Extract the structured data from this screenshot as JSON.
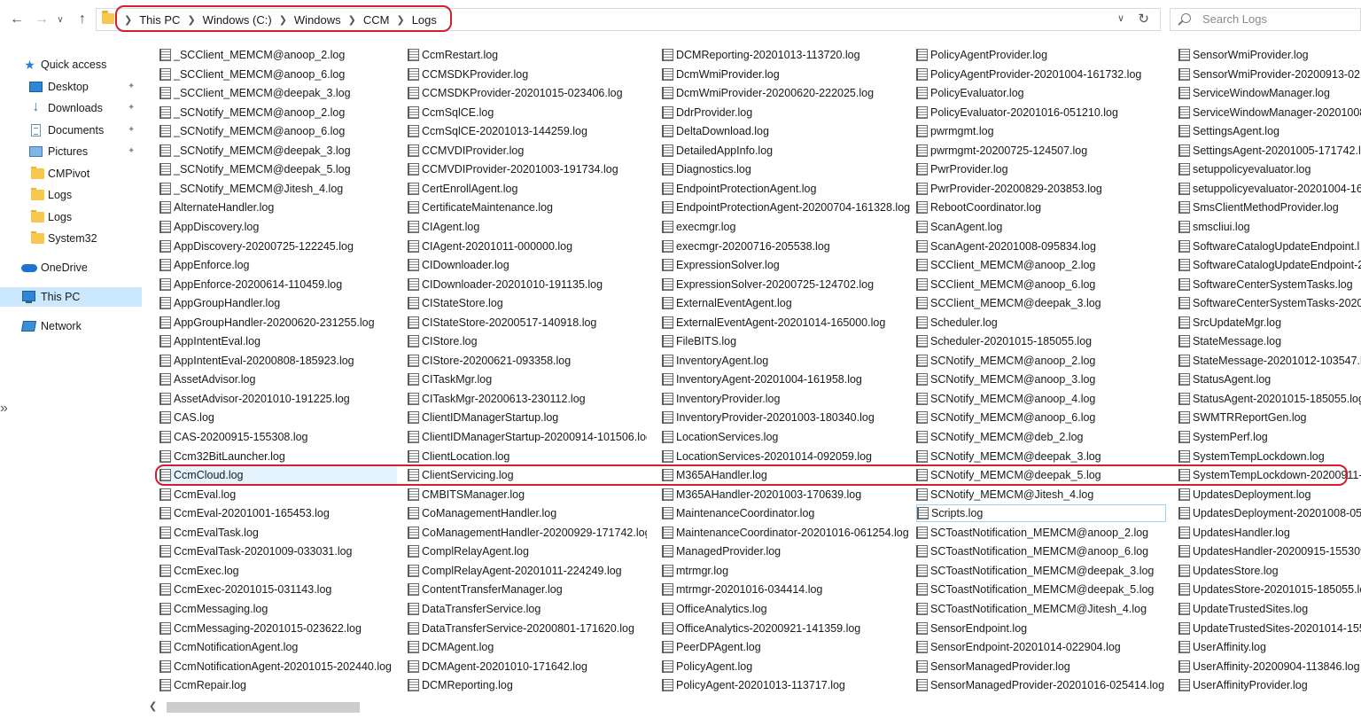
{
  "window": {
    "breadcrumb": [
      "This PC",
      "Windows (C:)",
      "Windows",
      "CCM",
      "Logs"
    ],
    "search_placeholder": "Search Logs"
  },
  "nav": {
    "back_icon": "arrow-left-icon",
    "forward_icon": "arrow-right-icon",
    "up_icon": "arrow-up-icon",
    "items": [
      {
        "label": "Quick access",
        "icon": "star-icon",
        "pinned": false
      },
      {
        "label": "Desktop",
        "icon": "desktop-icon",
        "pinned": true
      },
      {
        "label": "Downloads",
        "icon": "download-icon",
        "pinned": true
      },
      {
        "label": "Documents",
        "icon": "document-icon",
        "pinned": true
      },
      {
        "label": "Pictures",
        "icon": "pictures-icon",
        "pinned": true
      },
      {
        "label": "CMPivot",
        "icon": "folder-icon",
        "pinned": false
      },
      {
        "label": "Logs",
        "icon": "folder-icon",
        "pinned": false
      },
      {
        "label": "Logs",
        "icon": "folder-icon",
        "pinned": false
      },
      {
        "label": "System32",
        "icon": "folder-icon",
        "pinned": false
      },
      {
        "label": "OneDrive",
        "icon": "cloud-icon",
        "pinned": false
      },
      {
        "label": "This PC",
        "icon": "computer-icon",
        "pinned": false,
        "selected": true
      },
      {
        "label": "Network",
        "icon": "network-icon",
        "pinned": false
      }
    ]
  },
  "files": {
    "columns": [
      [
        "_SCClient_MEMCM@anoop_2.log",
        "_SCClient_MEMCM@anoop_6.log",
        "_SCClient_MEMCM@deepak_3.log",
        "_SCNotify_MEMCM@anoop_2.log",
        "_SCNotify_MEMCM@anoop_6.log",
        "_SCNotify_MEMCM@deepak_3.log",
        "_SCNotify_MEMCM@deepak_5.log",
        "_SCNotify_MEMCM@Jitesh_4.log",
        "AlternateHandler.log",
        "AppDiscovery.log",
        "AppDiscovery-20200725-122245.log",
        "AppEnforce.log",
        "AppEnforce-20200614-110459.log",
        "AppGroupHandler.log",
        "AppGroupHandler-20200620-231255.log",
        "AppIntentEval.log",
        "AppIntentEval-20200808-185923.log",
        "AssetAdvisor.log",
        "AssetAdvisor-20201010-191225.log",
        "CAS.log",
        "CAS-20200915-155308.log",
        "Ccm32BitLauncher.log",
        "CcmCloud.log",
        "CcmEval.log",
        "CcmEval-20201001-165453.log",
        "CcmEvalTask.log",
        "CcmEvalTask-20201009-033031.log",
        "CcmExec.log",
        "CcmExec-20201015-031143.log",
        "CcmMessaging.log",
        "CcmMessaging-20201015-023622.log",
        "CcmNotificationAgent.log",
        "CcmNotificationAgent-20201015-202440.log",
        "CcmRepair.log"
      ],
      [
        "CcmRestart.log",
        "CCMSDKProvider.log",
        "CCMSDKProvider-20201015-023406.log",
        "CcmSqlCE.log",
        "CcmSqlCE-20201013-144259.log",
        "CCMVDIProvider.log",
        "CCMVDIProvider-20201003-191734.log",
        "CertEnrollAgent.log",
        "CertificateMaintenance.log",
        "CIAgent.log",
        "CIAgent-20201011-000000.log",
        "CIDownloader.log",
        "CIDownloader-20201010-191135.log",
        "CIStateStore.log",
        "CIStateStore-20200517-140918.log",
        "CIStore.log",
        "CIStore-20200621-093358.log",
        "CITaskMgr.log",
        "CITaskMgr-20200613-230112.log",
        "ClientIDManagerStartup.log",
        "ClientIDManagerStartup-20200914-101506.log",
        "ClientLocation.log",
        "ClientServicing.log",
        "CMBITSManager.log",
        "CoManagementHandler.log",
        "CoManagementHandler-20200929-171742.log",
        "ComplRelayAgent.log",
        "ComplRelayAgent-20201011-224249.log",
        "ContentTransferManager.log",
        "DataTransferService.log",
        "DataTransferService-20200801-171620.log",
        "DCMAgent.log",
        "DCMAgent-20201010-171642.log",
        "DCMReporting.log"
      ],
      [
        "DCMReporting-20201013-113720.log",
        "DcmWmiProvider.log",
        "DcmWmiProvider-20200620-222025.log",
        "DdrProvider.log",
        "DeltaDownload.log",
        "DetailedAppInfo.log",
        "Diagnostics.log",
        "EndpointProtectionAgent.log",
        "EndpointProtectionAgent-20200704-161328.log",
        "execmgr.log",
        "execmgr-20200716-205538.log",
        "ExpressionSolver.log",
        "ExpressionSolver-20200725-124702.log",
        "ExternalEventAgent.log",
        "ExternalEventAgent-20201014-165000.log",
        "FileBITS.log",
        "InventoryAgent.log",
        "InventoryAgent-20201004-161958.log",
        "InventoryProvider.log",
        "InventoryProvider-20201003-180340.log",
        "LocationServices.log",
        "LocationServices-20201014-092059.log",
        "M365AHandler.log",
        "M365AHandler-20201003-170639.log",
        "MaintenanceCoordinator.log",
        "MaintenanceCoordinator-20201016-061254.log",
        "ManagedProvider.log",
        "mtrmgr.log",
        "mtrmgr-20201016-034414.log",
        "OfficeAnalytics.log",
        "OfficeAnalytics-20200921-141359.log",
        "PeerDPAgent.log",
        "PolicyAgent.log",
        "PolicyAgent-20201013-113717.log"
      ],
      [
        "PolicyAgentProvider.log",
        "PolicyAgentProvider-20201004-161732.log",
        "PolicyEvaluator.log",
        "PolicyEvaluator-20201016-051210.log",
        "pwrmgmt.log",
        "pwrmgmt-20200725-124507.log",
        "PwrProvider.log",
        "PwrProvider-20200829-203853.log",
        "RebootCoordinator.log",
        "ScanAgent.log",
        "ScanAgent-20201008-095834.log",
        "SCClient_MEMCM@anoop_2.log",
        "SCClient_MEMCM@anoop_6.log",
        "SCClient_MEMCM@deepak_3.log",
        "Scheduler.log",
        "Scheduler-20201015-185055.log",
        "SCNotify_MEMCM@anoop_2.log",
        "SCNotify_MEMCM@anoop_3.log",
        "SCNotify_MEMCM@anoop_4.log",
        "SCNotify_MEMCM@anoop_6.log",
        "SCNotify_MEMCM@deb_2.log",
        "SCNotify_MEMCM@deepak_3.log",
        "SCNotify_MEMCM@deepak_5.log",
        "SCNotify_MEMCM@Jitesh_4.log",
        "Scripts.log",
        "SCToastNotification_MEMCM@anoop_2.log",
        "SCToastNotification_MEMCM@anoop_6.log",
        "SCToastNotification_MEMCM@deepak_3.log",
        "SCToastNotification_MEMCM@deepak_5.log",
        "SCToastNotification_MEMCM@Jitesh_4.log",
        "SensorEndpoint.log",
        "SensorEndpoint-20201014-022904.log",
        "SensorManagedProvider.log",
        "SensorManagedProvider-20201016-025414.log"
      ],
      [
        "SensorWmiProvider.log",
        "SensorWmiProvider-20200913-021",
        "ServiceWindowManager.log",
        "ServiceWindowManager-20201008",
        "SettingsAgent.log",
        "SettingsAgent-20201005-171742.lo",
        "setuppolicyevaluator.log",
        "setuppolicyevaluator-20201004-16",
        "SmsClientMethodProvider.log",
        "smscliui.log",
        "SoftwareCatalogUpdateEndpoint.l",
        "SoftwareCatalogUpdateEndpoint-2",
        "SoftwareCenterSystemTasks.log",
        "SoftwareCenterSystemTasks-20200",
        "SrcUpdateMgr.log",
        "StateMessage.log",
        "StateMessage-20201012-103547.lo",
        "StatusAgent.log",
        "StatusAgent-20201015-185055.log",
        "SWMTRReportGen.log",
        "SystemPerf.log",
        "SystemTempLockdown.log",
        "SystemTempLockdown-20200911-",
        "UpdatesDeployment.log",
        "UpdatesDeployment-20201008-054",
        "UpdatesHandler.log",
        "UpdatesHandler-20200915-155309.",
        "UpdatesStore.log",
        "UpdatesStore-20201015-185055.lo",
        "UpdateTrustedSites.log",
        "UpdateTrustedSites-20201014-1551",
        "UserAffinity.log",
        "UserAffinity-20200904-113846.log",
        "UserAffinityProvider.log"
      ]
    ],
    "selected": {
      "column": 0,
      "row": 22
    },
    "focused": {
      "column": 3,
      "row": 24
    },
    "file_icon": "log-file-icon"
  }
}
